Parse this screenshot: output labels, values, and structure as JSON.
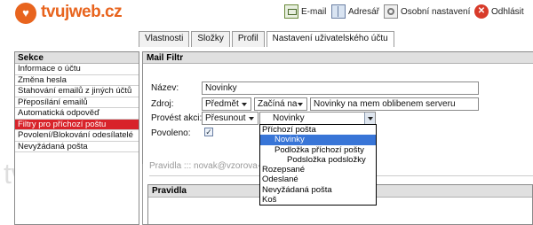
{
  "brand": {
    "name": "tvujweb.cz",
    "logo_icon": "heart-icon",
    "color": "#e8641e"
  },
  "topnav": {
    "email": {
      "label": "E-mail",
      "icon": "mail-icon"
    },
    "adresar": {
      "label": "Adresář",
      "icon": "address-book-icon"
    },
    "settings": {
      "label": "Osobní nastavení",
      "icon": "settings-icon"
    },
    "logout": {
      "label": "Odhlásit",
      "icon": "logout-icon"
    }
  },
  "tabs": [
    {
      "label": "Vlastnosti",
      "active": false
    },
    {
      "label": "Složky",
      "active": false
    },
    {
      "label": "Profil",
      "active": false
    },
    {
      "label": "Nastavení uživatelského účtu",
      "active": true
    }
  ],
  "sidebar": {
    "title": "Sekce",
    "items": [
      {
        "label": "Informace o účtu",
        "active": false
      },
      {
        "label": "Změna hesla",
        "active": false
      },
      {
        "label": "Stahování emailů z jiných účtů",
        "active": false
      },
      {
        "label": "Přeposílání emailů",
        "active": false
      },
      {
        "label": "Automatická odpověď",
        "active": false
      },
      {
        "label": "Filtry pro příchozí poštu",
        "active": true
      },
      {
        "label": "Povolení/Blokování odesílatelé",
        "active": false
      },
      {
        "label": "Nevyžádaná pošta",
        "active": false
      }
    ]
  },
  "mail_filter": {
    "title": "Mail Filtr",
    "name_label": "Název:",
    "name_value": "Novinky",
    "source_label": "Zdroj:",
    "source_field": "Předmět",
    "source_condition": "Začíná na",
    "source_value": "Novinky na mem oblibenem serveru",
    "action_label": "Provést akci:",
    "action_value": "Přesunout",
    "folder_value": "Novinky",
    "enabled_label": "Povoleno:",
    "enabled": true,
    "folder_options": [
      {
        "label": "Příchozí pošta",
        "indent": 0,
        "selected": false
      },
      {
        "label": "Novinky",
        "indent": 1,
        "selected": true
      },
      {
        "label": "Podložka příchozí pošty",
        "indent": 1,
        "selected": false
      },
      {
        "label": "Podsložka podsložky",
        "indent": 2,
        "selected": false
      },
      {
        "label": "Rozepsané",
        "indent": 0,
        "selected": false
      },
      {
        "label": "Odeslané",
        "indent": 0,
        "selected": false
      },
      {
        "label": "Nevyžádaná pošta",
        "indent": 0,
        "selected": false
      },
      {
        "label": "Koš",
        "indent": 0,
        "selected": false
      }
    ]
  },
  "rules": {
    "caption": "Pravidla ::: novak@vzorova-",
    "title": "Pravidla"
  },
  "watermark": "tvujweb.cz",
  "colors": {
    "accent": "#d8232a",
    "selection": "#3875d7"
  }
}
